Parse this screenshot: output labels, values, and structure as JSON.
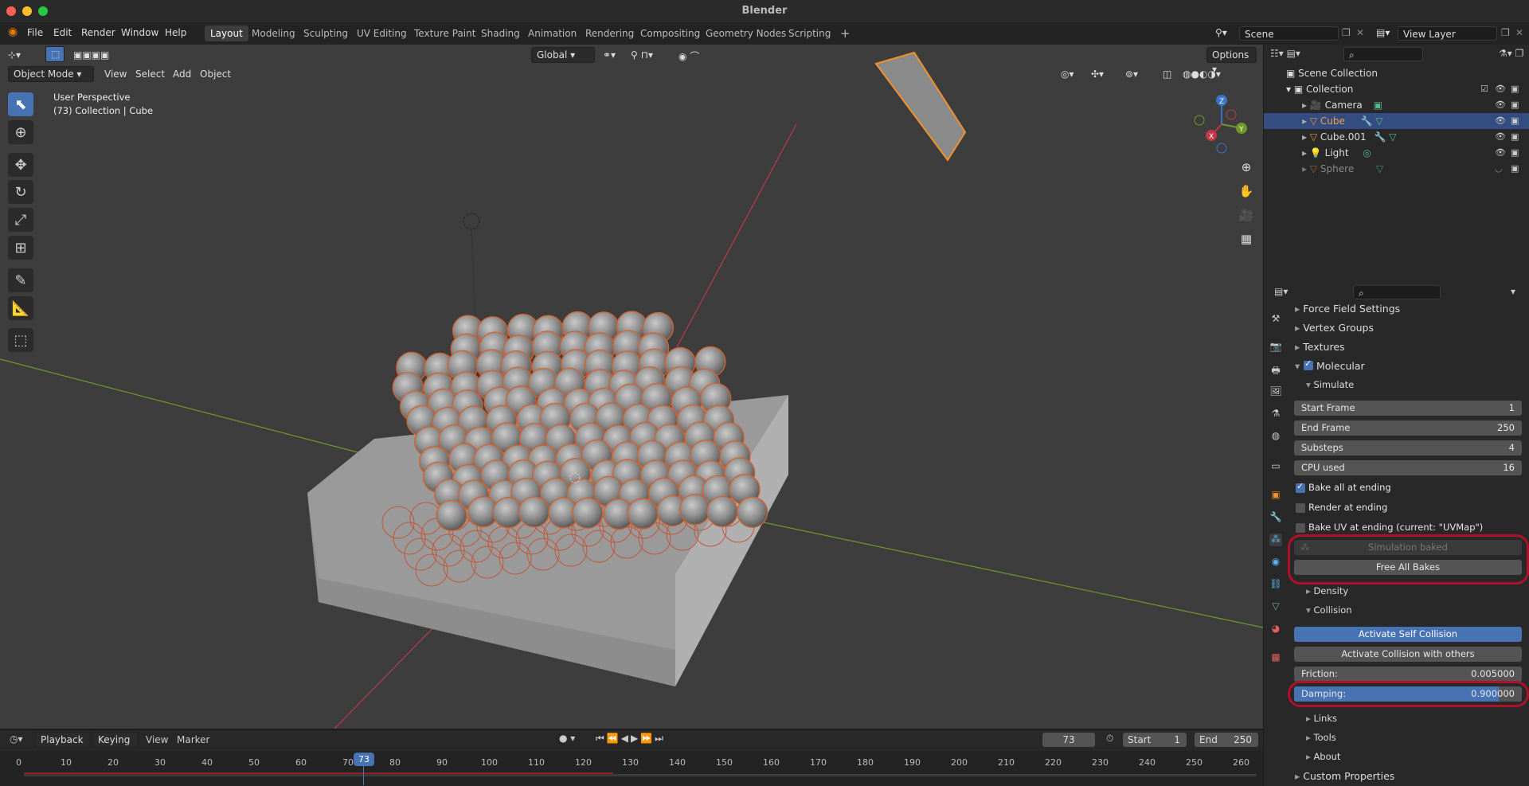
{
  "window": {
    "title": "Blender"
  },
  "menu": [
    "File",
    "Edit",
    "Render",
    "Window",
    "Help"
  ],
  "workspaces": [
    "Layout",
    "Modeling",
    "Sculpting",
    "UV Editing",
    "Texture Paint",
    "Shading",
    "Animation",
    "Rendering",
    "Compositing",
    "Geometry Nodes",
    "Scripting"
  ],
  "active_workspace": "Layout",
  "scene": {
    "name": "Scene",
    "view_layer": "View Layer"
  },
  "viewport": {
    "mode": "Object Mode",
    "menus": [
      "View",
      "Select",
      "Add",
      "Object"
    ],
    "transform_orientation": "Global",
    "options_label": "Options",
    "overlay_text": {
      "perspective": "User Perspective",
      "context": "(73) Collection | Cube"
    },
    "gizmo_axes": {
      "x": "X",
      "y": "Y",
      "z": "Z"
    },
    "colors": {
      "background": "#3d3d3d",
      "x_axis": "#c0394b",
      "y_axis": "#6e9a2a",
      "selection": "#f0922b"
    }
  },
  "outliner": {
    "root": "Scene Collection",
    "collection": "Collection",
    "items": [
      {
        "name": "Camera",
        "selected": false
      },
      {
        "name": "Cube",
        "selected": true
      },
      {
        "name": "Cube.001",
        "selected": false
      },
      {
        "name": "Light",
        "selected": false
      },
      {
        "name": "Sphere",
        "selected": false
      }
    ]
  },
  "properties": {
    "sections": {
      "force_field": "Force Field Settings",
      "vertex_groups": "Vertex Groups",
      "textures": "Textures",
      "molecular": "Molecular",
      "simulate": "Simulate",
      "density": "Density",
      "collision": "Collision",
      "links": "Links",
      "tools": "Tools",
      "about": "About",
      "custom_properties": "Custom Properties"
    },
    "fields": {
      "start_frame": {
        "label": "Start Frame",
        "value": "1"
      },
      "end_frame": {
        "label": "End Frame",
        "value": "250"
      },
      "substeps": {
        "label": "Substeps",
        "value": "4"
      },
      "cpu_used": {
        "label": "CPU used",
        "value": "16"
      },
      "friction": {
        "label": "Friction:",
        "value": "0.005000"
      },
      "damping": {
        "label": "Damping:",
        "value": "0.900000",
        "fill": 0.9
      }
    },
    "checkboxes": {
      "bake_all": {
        "label": "Bake all at ending",
        "checked": true
      },
      "render_at_ending": {
        "label": "Render at ending",
        "checked": false
      },
      "bake_uv": {
        "label": "Bake UV at ending (current: \"UVMap\")",
        "checked": false
      }
    },
    "buttons": {
      "simulation_baked": "Simulation baked",
      "free_all_bakes": "Free All Bakes",
      "activate_self_collision": "Activate Self Collision",
      "activate_collision_others": "Activate Collision with others"
    }
  },
  "timeline": {
    "menus": [
      "Playback",
      "Keying",
      "View",
      "Marker"
    ],
    "current_frame": "73",
    "start_label": "Start",
    "start": "1",
    "end_label": "End",
    "end": "250",
    "ticks": [
      "0",
      "10",
      "20",
      "30",
      "40",
      "50",
      "60",
      "70",
      "80",
      "90",
      "100",
      "110",
      "120",
      "130",
      "140",
      "150",
      "160",
      "170",
      "180",
      "190",
      "200",
      "210",
      "220",
      "230",
      "240",
      "250",
      "260"
    ]
  }
}
